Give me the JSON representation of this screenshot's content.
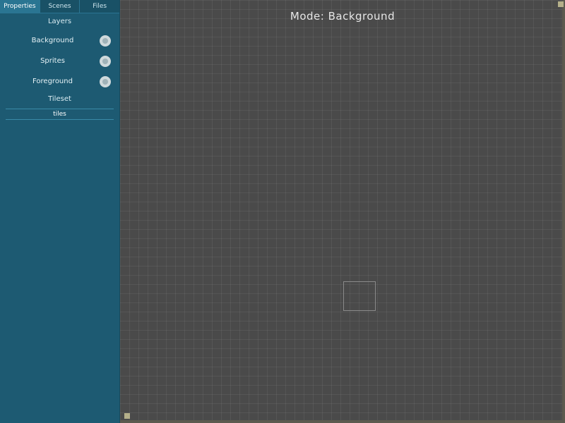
{
  "sidebar": {
    "tabs": [
      {
        "label": "Properties",
        "active": true
      },
      {
        "label": "Scenes",
        "active": false
      },
      {
        "label": "Files",
        "active": false
      }
    ],
    "layers_heading": "Layers",
    "layers": [
      {
        "label": "Background",
        "icon": "toggle-icon"
      },
      {
        "label": "Sprites",
        "icon": "toggle-icon"
      },
      {
        "label": "Foreground",
        "icon": "toggle-icon"
      }
    ],
    "subheading": "Tileset",
    "field_value": "tiles"
  },
  "canvas": {
    "title": "Mode: Background"
  },
  "colors": {
    "sidebar_bg": "#1d5a72",
    "canvas_bg": "#4a4a4a",
    "marker": "#b5b08a"
  }
}
